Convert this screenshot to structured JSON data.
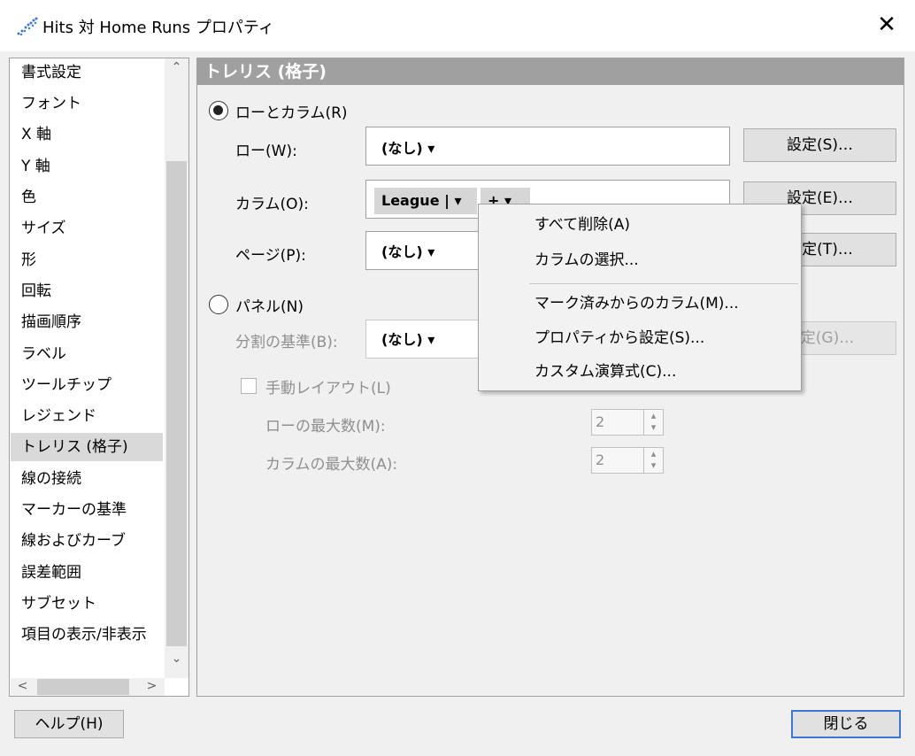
{
  "window": {
    "title": "Hits 対 Home Runs プロパティ",
    "close_glyph": "✕"
  },
  "nav": {
    "items": [
      "書式設定",
      "フォント",
      "X 軸",
      "Y 軸",
      "色",
      "サイズ",
      "形",
      "回転",
      "描画順序",
      "ラベル",
      "ツールチップ",
      "レジェンド",
      "トレリス (格子)",
      "線の接続",
      "マーカーの基準",
      "線およびカーブ",
      "誤差範囲",
      "サブセット",
      "項目の表示/非表示"
    ],
    "selected": "トレリス (格子)"
  },
  "panel": {
    "title": "トレリス (格子)",
    "rows_columns": {
      "label": "ローとカラム(R)",
      "row_label": "ロー(W):",
      "row_value": "(なし)",
      "row_button": "設定(S)…",
      "column_label": "カラム(O):",
      "column_value": "League",
      "column_add": "+",
      "column_button": "設定(E)…",
      "page_label": "ページ(P):",
      "page_value": "(なし)",
      "page_button": "設定(T)…"
    },
    "panels": {
      "label": "パネル(N)",
      "split_label": "分割の基準(B):",
      "split_value": "(なし)",
      "split_button": "設定(G)…",
      "manual_layout_label": "手動レイアウト(L)",
      "max_rows_label": "ローの最大数(M):",
      "max_rows_value": "2",
      "max_columns_label": "カラムの最大数(A):",
      "max_columns_value": "2"
    }
  },
  "menu": {
    "items": [
      "すべて削除(A)",
      "カラムの選択...",
      "マーク済みからのカラム(M)...",
      "プロパティから設定(S)...",
      "カスタム演算式(C)..."
    ]
  },
  "footer": {
    "help_button": "ヘルプ(H)",
    "close_button": "閉じる"
  },
  "icons": {
    "dropdown": "▾",
    "scroll_up": "⌃",
    "scroll_down": "⌄",
    "scroll_left": "<",
    "scroll_right": ">",
    "spin_up": "▴",
    "spin_down": "▾"
  },
  "colors": {
    "panel_header": "#a0a0a0",
    "selected_nav": "#d9d9d9",
    "title_icon": "#3c78d8"
  }
}
